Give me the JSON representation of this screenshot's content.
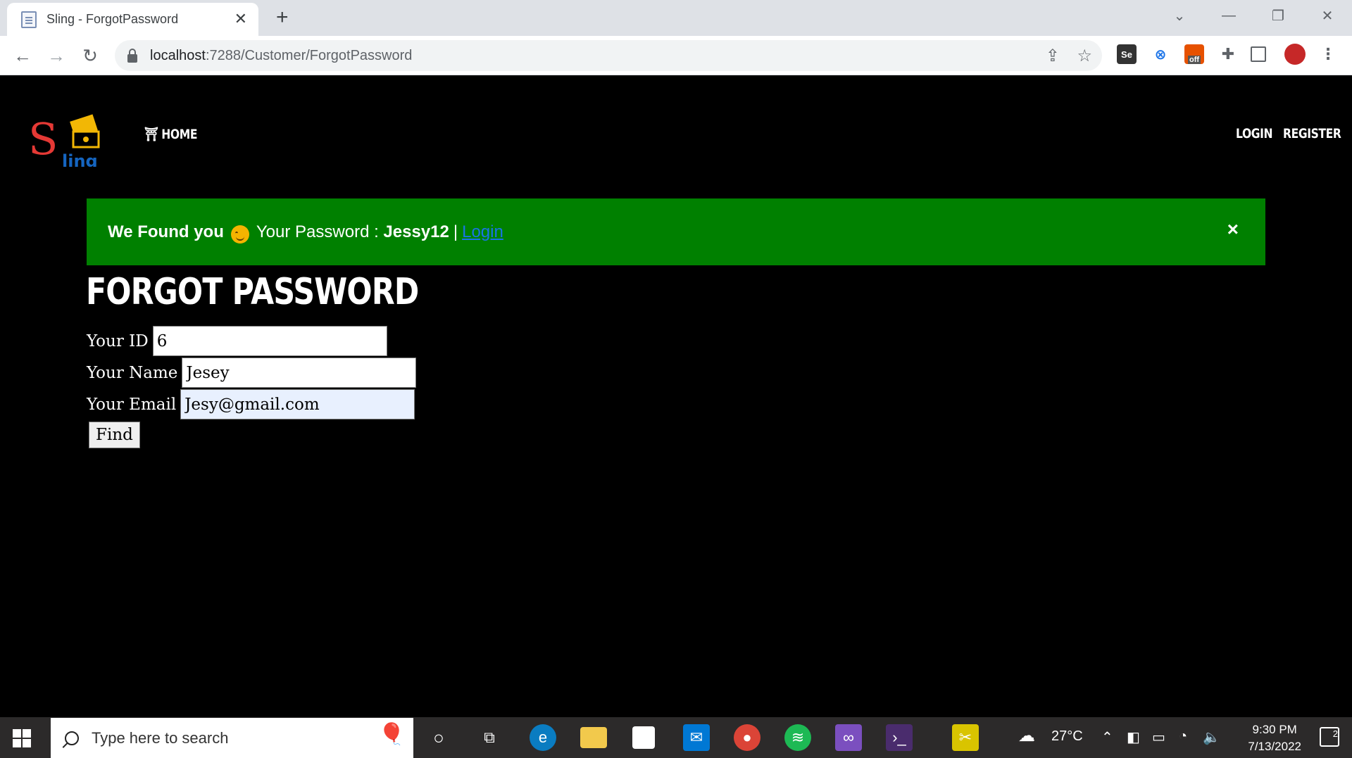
{
  "browser": {
    "tab_title": "Sling - ForgotPassword",
    "url_host": "localhost",
    "url_path": ":7288/Customer/ForgotPassword",
    "ext_off_label": "off",
    "ext_se_label": "Se"
  },
  "nav": {
    "home": "HOME",
    "login": "LOGIN",
    "register": "REGISTER",
    "logo_letter": "S",
    "logo_rest": "ling"
  },
  "alert": {
    "found_text": "We Found you",
    "password_label": "Your Password :",
    "password_value": "Jessy12",
    "separator": "|",
    "login_link": "Login",
    "close": "×"
  },
  "page": {
    "title": "FORGOT PASSWORD"
  },
  "form": {
    "id_label": "Your ID",
    "id_value": "6",
    "name_label": "Your Name",
    "name_value": "Jesey",
    "email_label": "Your Email",
    "email_value": "Jesy@gmail.com",
    "find_button": "Find"
  },
  "taskbar": {
    "search_placeholder": "Type here to search",
    "weather": "27°C",
    "time": "9:30 PM",
    "date": "7/13/2022",
    "notification_count": "2"
  },
  "colors": {
    "alert_bg": "#008000",
    "page_bg": "#000000",
    "link": "#1a73e8",
    "logo_red": "#e53935",
    "logo_blue": "#1565c0",
    "logo_gold": "#f2b705"
  }
}
